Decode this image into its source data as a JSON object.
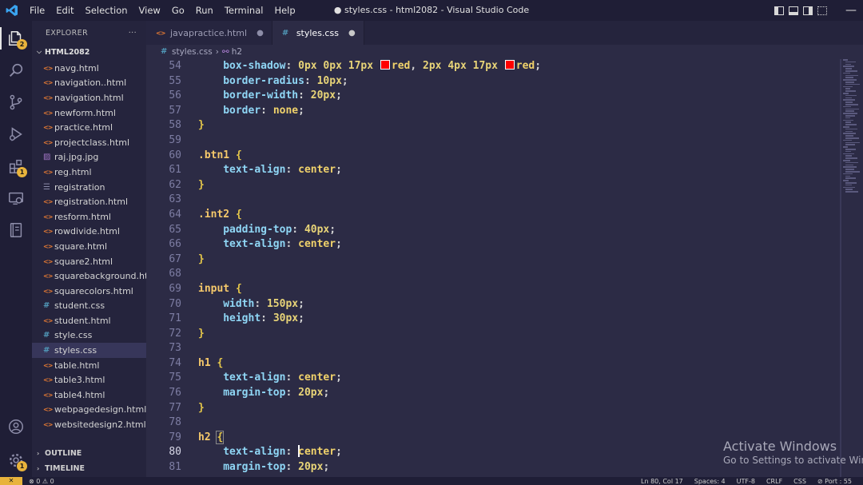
{
  "window": {
    "title": "● styles.css - html2082 - Visual Studio Code",
    "menu": [
      "File",
      "Edit",
      "Selection",
      "View",
      "Go",
      "Run",
      "Terminal",
      "Help"
    ]
  },
  "activity_bar": {
    "explorer_badge": "2",
    "extensions_badge": "1",
    "accounts_badge": "1"
  },
  "sidebar": {
    "header": "EXPLORER",
    "more": "···",
    "folder": "HTML2082",
    "files": [
      {
        "name": "navg.html",
        "type": "html"
      },
      {
        "name": "navigation..html",
        "type": "html"
      },
      {
        "name": "navigation.html",
        "type": "html"
      },
      {
        "name": "newform.html",
        "type": "html"
      },
      {
        "name": "practice.html",
        "type": "html"
      },
      {
        "name": "projectclass.html",
        "type": "html"
      },
      {
        "name": "raj.jpg.jpg",
        "type": "img"
      },
      {
        "name": "reg.html",
        "type": "html"
      },
      {
        "name": "registration",
        "type": "plain"
      },
      {
        "name": "registration.html",
        "type": "html"
      },
      {
        "name": "resform.html",
        "type": "html"
      },
      {
        "name": "rowdivide.html",
        "type": "html"
      },
      {
        "name": "square.html",
        "type": "html"
      },
      {
        "name": "square2.html",
        "type": "html"
      },
      {
        "name": "squarebackground.ht...",
        "type": "html"
      },
      {
        "name": "squarecolors.html",
        "type": "html"
      },
      {
        "name": "student.css",
        "type": "css"
      },
      {
        "name": "student.html",
        "type": "html"
      },
      {
        "name": "style.css",
        "type": "css"
      },
      {
        "name": "styles.css",
        "type": "css",
        "selected": true
      },
      {
        "name": "table.html",
        "type": "html"
      },
      {
        "name": "table3.html",
        "type": "html"
      },
      {
        "name": "table4.html",
        "type": "html"
      },
      {
        "name": "webpagedesign.html",
        "type": "html"
      },
      {
        "name": "websitedesign2.html",
        "type": "html"
      }
    ],
    "outline": "OUTLINE",
    "timeline": "TIMELINE"
  },
  "tabs": [
    {
      "label": "javapractice.html",
      "type": "html",
      "modified": true,
      "active": false
    },
    {
      "label": "styles.css",
      "type": "css",
      "modified": true,
      "active": true
    }
  ],
  "breadcrumbs": {
    "file": "styles.css",
    "symbol": "h2"
  },
  "code_lines": [
    {
      "n": "54",
      "indent": 1,
      "tokens": [
        [
          "prop",
          "box-shadow"
        ],
        [
          "punc",
          ": "
        ],
        [
          "num",
          "0px 0px 17px "
        ],
        [
          "swatch",
          ""
        ],
        [
          "val",
          "red"
        ],
        [
          "punc",
          ", "
        ],
        [
          "num",
          "2px 4px 17px "
        ],
        [
          "swatch",
          ""
        ],
        [
          "val",
          "red"
        ],
        [
          "punc",
          ";"
        ]
      ]
    },
    {
      "n": "55",
      "indent": 1,
      "tokens": [
        [
          "prop",
          "border-radius"
        ],
        [
          "punc",
          ": "
        ],
        [
          "num",
          "10px"
        ],
        [
          "punc",
          ";"
        ]
      ]
    },
    {
      "n": "56",
      "indent": 1,
      "tokens": [
        [
          "prop",
          "border-width"
        ],
        [
          "punc",
          ": "
        ],
        [
          "num",
          "20px"
        ],
        [
          "punc",
          ";"
        ]
      ]
    },
    {
      "n": "57",
      "indent": 1,
      "tokens": [
        [
          "prop",
          "border"
        ],
        [
          "punc",
          ": "
        ],
        [
          "val",
          "none"
        ],
        [
          "punc",
          ";"
        ]
      ]
    },
    {
      "n": "58",
      "indent": 0,
      "tokens": [
        [
          "brace",
          "}"
        ]
      ]
    },
    {
      "n": "59",
      "indent": 0,
      "tokens": []
    },
    {
      "n": "60",
      "indent": 0,
      "tokens": [
        [
          "sel",
          ".btn1"
        ],
        [
          "punc",
          " "
        ],
        [
          "brace",
          "{"
        ]
      ]
    },
    {
      "n": "61",
      "indent": 1,
      "tokens": [
        [
          "prop",
          "text-align"
        ],
        [
          "punc",
          ": "
        ],
        [
          "val",
          "center"
        ],
        [
          "punc",
          ";"
        ]
      ]
    },
    {
      "n": "62",
      "indent": 0,
      "tokens": [
        [
          "brace",
          "}"
        ]
      ]
    },
    {
      "n": "63",
      "indent": 0,
      "tokens": []
    },
    {
      "n": "64",
      "indent": 0,
      "tokens": [
        [
          "sel",
          ".int2"
        ],
        [
          "punc",
          " "
        ],
        [
          "brace",
          "{"
        ]
      ]
    },
    {
      "n": "65",
      "indent": 1,
      "tokens": [
        [
          "prop",
          "padding-top"
        ],
        [
          "punc",
          ": "
        ],
        [
          "num",
          "40px"
        ],
        [
          "punc",
          ";"
        ]
      ]
    },
    {
      "n": "66",
      "indent": 1,
      "tokens": [
        [
          "prop",
          "text-align"
        ],
        [
          "punc",
          ": "
        ],
        [
          "val",
          "center"
        ],
        [
          "punc",
          ";"
        ]
      ]
    },
    {
      "n": "67",
      "indent": 0,
      "tokens": [
        [
          "brace",
          "}"
        ]
      ]
    },
    {
      "n": "68",
      "indent": 0,
      "tokens": []
    },
    {
      "n": "69",
      "indent": 0,
      "tokens": [
        [
          "sel",
          "input"
        ],
        [
          "punc",
          " "
        ],
        [
          "brace",
          "{"
        ]
      ]
    },
    {
      "n": "70",
      "indent": 1,
      "tokens": [
        [
          "prop",
          "width"
        ],
        [
          "punc",
          ": "
        ],
        [
          "num",
          "150px"
        ],
        [
          "punc",
          ";"
        ]
      ]
    },
    {
      "n": "71",
      "indent": 1,
      "tokens": [
        [
          "prop",
          "height"
        ],
        [
          "punc",
          ": "
        ],
        [
          "num",
          "30px"
        ],
        [
          "punc",
          ";"
        ]
      ]
    },
    {
      "n": "72",
      "indent": 0,
      "tokens": [
        [
          "brace",
          "}"
        ]
      ]
    },
    {
      "n": "73",
      "indent": 0,
      "tokens": []
    },
    {
      "n": "74",
      "indent": 0,
      "tokens": [
        [
          "sel",
          "h1"
        ],
        [
          "punc",
          " "
        ],
        [
          "brace",
          "{"
        ]
      ]
    },
    {
      "n": "75",
      "indent": 1,
      "tokens": [
        [
          "prop",
          "text-align"
        ],
        [
          "punc",
          ": "
        ],
        [
          "val",
          "center"
        ],
        [
          "punc",
          ";"
        ]
      ]
    },
    {
      "n": "76",
      "indent": 1,
      "tokens": [
        [
          "prop",
          "margin-top"
        ],
        [
          "punc",
          ": "
        ],
        [
          "num",
          "20px"
        ],
        [
          "punc",
          ";"
        ]
      ]
    },
    {
      "n": "77",
      "indent": 0,
      "tokens": [
        [
          "brace",
          "}"
        ]
      ]
    },
    {
      "n": "78",
      "indent": 0,
      "tokens": []
    },
    {
      "n": "79",
      "indent": 0,
      "tokens": [
        [
          "sel",
          "h2"
        ],
        [
          "punc",
          " "
        ],
        [
          "bracematch",
          "{"
        ]
      ]
    },
    {
      "n": "80",
      "indent": 1,
      "current": true,
      "tokens": [
        [
          "prop",
          "text-align"
        ],
        [
          "punc",
          ": "
        ],
        [
          "cursor",
          ""
        ],
        [
          "val",
          "center"
        ],
        [
          "punc",
          ";"
        ]
      ]
    },
    {
      "n": "81",
      "indent": 1,
      "tokens": [
        [
          "prop",
          "margin-top"
        ],
        [
          "punc",
          ": "
        ],
        [
          "num",
          "20px"
        ],
        [
          "punc",
          ";"
        ]
      ]
    }
  ],
  "watermark": {
    "line1": "Activate Windows",
    "line2": "Go to Settings to activate Wind"
  },
  "status": {
    "problems": "⊗ 0 ⚠ 0",
    "position": "Ln 80, Col 17",
    "spaces": "Spaces: 4",
    "encoding": "UTF-8",
    "eol": "CRLF",
    "language": "CSS",
    "port": "⊘ Port : 55"
  }
}
